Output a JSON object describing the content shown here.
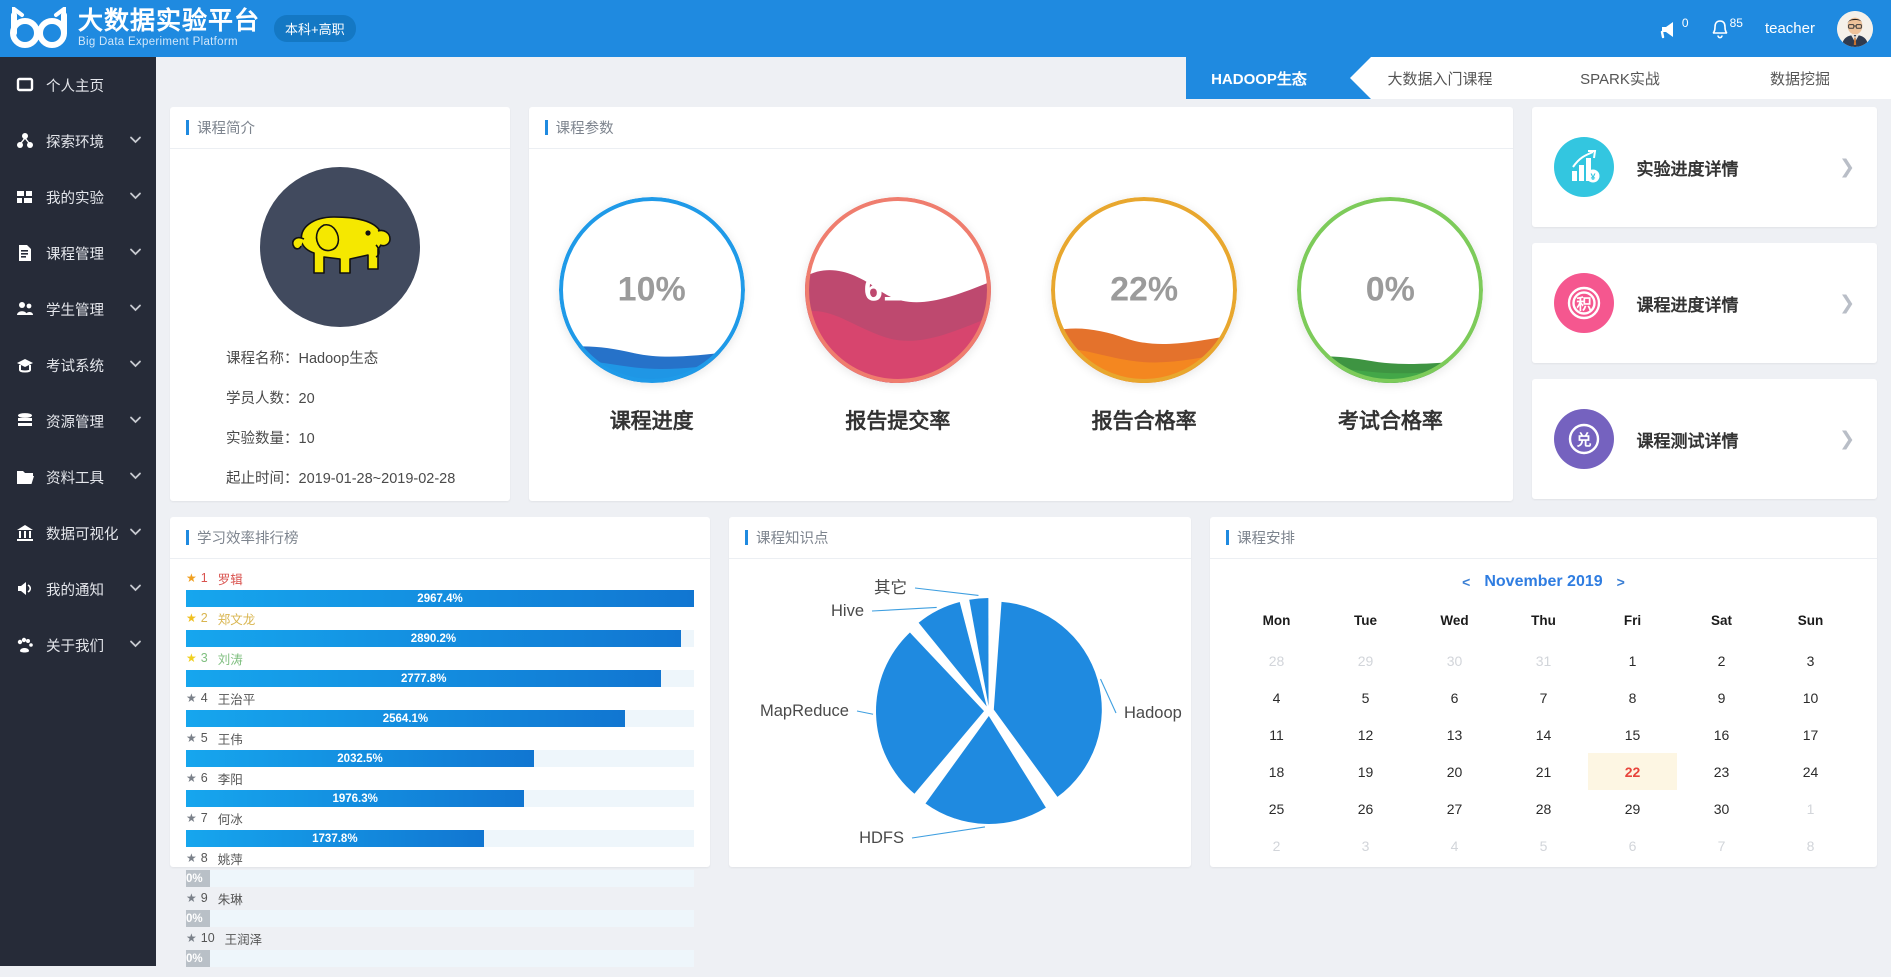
{
  "header": {
    "logo_cn": "大数据实验平台",
    "logo_en": "Big Data Experiment Platform",
    "badge": "本科+高职",
    "megaphone_count": "0",
    "bell_count": "85",
    "username": "teacher"
  },
  "sidebar": {
    "items": [
      {
        "label": "个人主页",
        "icon": "home-icon",
        "expandable": false
      },
      {
        "label": "探索环境",
        "icon": "cluster-icon",
        "expandable": true
      },
      {
        "label": "我的实验",
        "icon": "grid-icon",
        "expandable": true
      },
      {
        "label": "课程管理",
        "icon": "document-icon",
        "expandable": true
      },
      {
        "label": "学生管理",
        "icon": "users-icon",
        "expandable": true
      },
      {
        "label": "考试系统",
        "icon": "graduation-cap-icon",
        "expandable": true
      },
      {
        "label": "资源管理",
        "icon": "database-icon",
        "expandable": true
      },
      {
        "label": "资料工具",
        "icon": "folder-icon",
        "expandable": true
      },
      {
        "label": "数据可视化",
        "icon": "bank-icon",
        "expandable": true
      },
      {
        "label": "我的通知",
        "icon": "speaker-icon",
        "expandable": true
      },
      {
        "label": "关于我们",
        "icon": "paw-icon",
        "expandable": true
      }
    ]
  },
  "tabs": [
    {
      "label": "HADOOP生态",
      "active": true
    },
    {
      "label": "大数据入门课程",
      "active": false
    },
    {
      "label": "SPARK实战",
      "active": false
    },
    {
      "label": "数据挖掘",
      "active": false
    }
  ],
  "intro": {
    "title": "课程简介",
    "logo_alt": "hadoop-elephant-logo",
    "lines": [
      "课程名称：Hadoop生态",
      "学员人数：20",
      "实验数量：10",
      "起止时间：2019-01-28~2019-02-28"
    ]
  },
  "params": {
    "title": "课程参数",
    "gauges": [
      {
        "value": "10%",
        "percent": 10,
        "label": "课程进度",
        "color": "#1f9ae8",
        "wave_dark": "#1466c4",
        "wave_light": "#1f9ae8",
        "text_color": "#9b9b9b"
      },
      {
        "value": "61%",
        "percent": 61,
        "label": "报告提交率",
        "color": "#ef7d6e",
        "wave_dark": "#b83a63",
        "wave_light": "#d9456e",
        "text_color": "#ffffff"
      },
      {
        "value": "22%",
        "percent": 22,
        "label": "报告合格率",
        "color": "#e8a72e",
        "wave_dark": "#e2661a",
        "wave_light": "#f5891f",
        "text_color": "#9b9b9b"
      },
      {
        "value": "0%",
        "percent": 4,
        "label": "考试合格率",
        "color": "#7dcb5a",
        "wave_dark": "#2e8b32",
        "wave_light": "#44a849",
        "text_color": "#9b9b9b"
      }
    ]
  },
  "side_cards": [
    {
      "label": "实验进度详情",
      "icon": "bar-chart-growth-icon",
      "color": "#33c6e0",
      "glyph": "¥"
    },
    {
      "label": "课程进度详情",
      "icon": "points-badge-icon",
      "color": "#f5578f",
      "glyph": "积"
    },
    {
      "label": "课程测试详情",
      "icon": "exchange-badge-icon",
      "color": "#7562bf",
      "glyph": "兑"
    }
  ],
  "ranking": {
    "title": "学习效率排行榜",
    "max_percent": 2967.4,
    "rows": [
      {
        "rank": "1",
        "name": "罗辑",
        "value": "2967.4%",
        "percent": 2967.4,
        "star_color": "#f0a020",
        "name_color": "#d9534f"
      },
      {
        "rank": "2",
        "name": "郑文龙",
        "value": "2890.2%",
        "percent": 2890.2,
        "star_color": "#f0c020",
        "name_color": "#d9b54f"
      },
      {
        "rank": "3",
        "name": "刘涛",
        "value": "2777.8%",
        "percent": 2777.8,
        "star_color": "#f0d020",
        "name_color": "#7fbf7f"
      },
      {
        "rank": "4",
        "name": "王治平",
        "value": "2564.1%",
        "percent": 2564.1,
        "star_color": "#7a8089",
        "name_color": "#555555"
      },
      {
        "rank": "5",
        "name": "王伟",
        "value": "2032.5%",
        "percent": 2032.5,
        "star_color": "#7a8089",
        "name_color": "#555555"
      },
      {
        "rank": "6",
        "name": "李阳",
        "value": "1976.3%",
        "percent": 1976.3,
        "star_color": "#7a8089",
        "name_color": "#555555"
      },
      {
        "rank": "7",
        "name": "何冰",
        "value": "1737.8%",
        "percent": 1737.8,
        "star_color": "#7a8089",
        "name_color": "#555555"
      },
      {
        "rank": "8",
        "name": "姚萍",
        "value": "0%",
        "percent": 0,
        "star_color": "#7a8089",
        "name_color": "#555555"
      },
      {
        "rank": "9",
        "name": "朱琳",
        "value": "0%",
        "percent": 0,
        "star_color": "#7a8089",
        "name_color": "#555555"
      },
      {
        "rank": "10",
        "name": "王润泽",
        "value": "0%",
        "percent": 0,
        "star_color": "#7a8089",
        "name_color": "#555555"
      }
    ]
  },
  "knowledge": {
    "title": "课程知识点"
  },
  "chart_data": {
    "type": "pie",
    "title": "课程知识点",
    "categories": [
      "Hadoop",
      "HDFS",
      "MapReduce",
      "Hive",
      "其它"
    ],
    "values": [
      40,
      20,
      28,
      8,
      4
    ],
    "labels": [
      "Hadoop",
      "HDFS",
      "MapReduce",
      "Hive",
      "其它"
    ],
    "color": "#1f8ae0",
    "legend": "none",
    "label_position": "outside-with-leader-lines"
  },
  "calendar": {
    "title": "课程安排",
    "prev": "<",
    "next": ">",
    "month": "November 2019",
    "dow": [
      "Mon",
      "Tue",
      "Wed",
      "Thu",
      "Fri",
      "Sat",
      "Sun"
    ],
    "weeks": [
      [
        {
          "d": "28",
          "m": true
        },
        {
          "d": "29",
          "m": true
        },
        {
          "d": "30",
          "m": true
        },
        {
          "d": "31",
          "m": true
        },
        {
          "d": "1"
        },
        {
          "d": "2"
        },
        {
          "d": "3"
        }
      ],
      [
        {
          "d": "4"
        },
        {
          "d": "5"
        },
        {
          "d": "6"
        },
        {
          "d": "7"
        },
        {
          "d": "8"
        },
        {
          "d": "9"
        },
        {
          "d": "10"
        }
      ],
      [
        {
          "d": "11"
        },
        {
          "d": "12"
        },
        {
          "d": "13"
        },
        {
          "d": "14"
        },
        {
          "d": "15"
        },
        {
          "d": "16"
        },
        {
          "d": "17"
        }
      ],
      [
        {
          "d": "18"
        },
        {
          "d": "19"
        },
        {
          "d": "20"
        },
        {
          "d": "21"
        },
        {
          "d": "22",
          "today": true
        },
        {
          "d": "23"
        },
        {
          "d": "24"
        }
      ],
      [
        {
          "d": "25"
        },
        {
          "d": "26"
        },
        {
          "d": "27"
        },
        {
          "d": "28"
        },
        {
          "d": "29"
        },
        {
          "d": "30"
        },
        {
          "d": "1",
          "m": true
        }
      ],
      [
        {
          "d": "2",
          "m": true
        },
        {
          "d": "3",
          "m": true
        },
        {
          "d": "4",
          "m": true
        },
        {
          "d": "5",
          "m": true
        },
        {
          "d": "6",
          "m": true
        },
        {
          "d": "7",
          "m": true
        },
        {
          "d": "8",
          "m": true
        }
      ]
    ]
  }
}
